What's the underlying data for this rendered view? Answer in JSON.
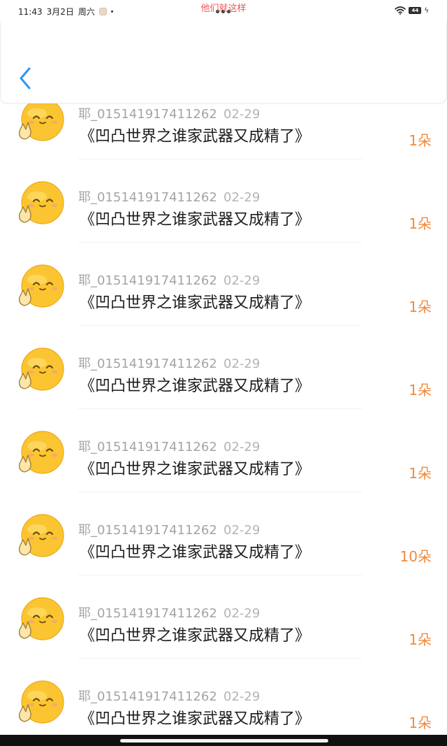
{
  "status_bar": {
    "time": "11:43",
    "date": "3月2日",
    "weekday": "周六",
    "battery": "44",
    "center_overlay_text": "他们就这样"
  },
  "colors": {
    "accent_blue": "#2b97f0",
    "flower_orange": "#f08a3e",
    "overlay_red": "#ef5350"
  },
  "header": {
    "back_icon": "chevron-left-icon"
  },
  "list": {
    "items": [
      {
        "user": "耶_015141917411262",
        "date": "02-29",
        "title": "《凹凸世界之谁家武器又成精了》",
        "count": "1朵"
      },
      {
        "user": "耶_015141917411262",
        "date": "02-29",
        "title": "《凹凸世界之谁家武器又成精了》",
        "count": "1朵"
      },
      {
        "user": "耶_015141917411262",
        "date": "02-29",
        "title": "《凹凸世界之谁家武器又成精了》",
        "count": "1朵"
      },
      {
        "user": "耶_015141917411262",
        "date": "02-29",
        "title": "《凹凸世界之谁家武器又成精了》",
        "count": "1朵"
      },
      {
        "user": "耶_015141917411262",
        "date": "02-29",
        "title": "《凹凸世界之谁家武器又成精了》",
        "count": "1朵"
      },
      {
        "user": "耶_015141917411262",
        "date": "02-29",
        "title": "《凹凸世界之谁家武器又成精了》",
        "count": "10朵"
      },
      {
        "user": "耶_015141917411262",
        "date": "02-29",
        "title": "《凹凸世界之谁家武器又成精了》",
        "count": "1朵"
      },
      {
        "user": "耶_015141917411262",
        "date": "02-29",
        "title": "《凹凸世界之谁家武器又成精了》",
        "count": "1朵"
      }
    ]
  }
}
